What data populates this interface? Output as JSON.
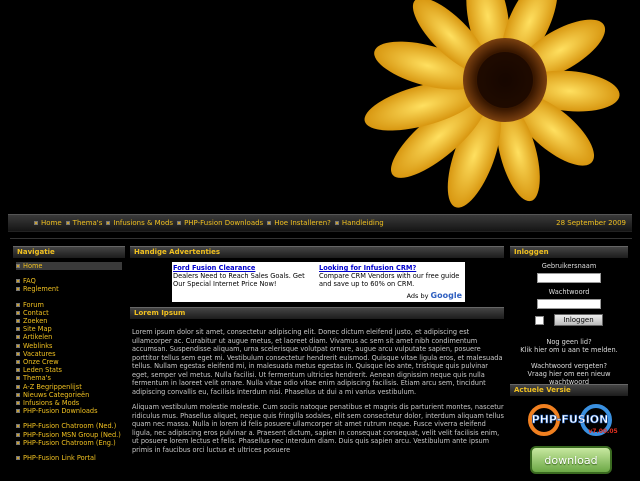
{
  "navbar": {
    "links": [
      "Home",
      "Thema's",
      "Infusions & Mods",
      "PHP-Fusion Downloads",
      "Hoe Installeren?",
      "Handleiding"
    ],
    "date": "28 September 2009"
  },
  "navigation": {
    "title": "Navigatie",
    "groups": [
      [
        "Home"
      ],
      [
        "FAQ",
        "Reglement"
      ],
      [
        "Forum",
        "Contact",
        "Zoeken",
        "Site Map",
        "Artikelen",
        "Weblinks",
        "Vacatures",
        "Onze Crew",
        "Leden Stats",
        "Thema's",
        "A-Z Begrippenlijst",
        "Nieuws Categorieën",
        "Infusions & Mods",
        "PHP-Fusion Downloads"
      ],
      [
        "PHP-Fusion Chatroom (Ned.)",
        "PHP-Fusion MSN Group (Ned.)",
        "PHP-Fusion Chatroom (Eng.)"
      ],
      [
        "PHP-Fusion Link Portal"
      ]
    ]
  },
  "ads": {
    "title": "Handige Advertenties",
    "items": [
      {
        "title": "Ford Fusion Clearance",
        "text": "Dealers Need to Reach Sales Goals. Get Our Special Internet Price Now!"
      },
      {
        "title": "Looking for Infusion CRM?",
        "text": "Compare CRM Vendors with our free guide and save up to 60% on CRM."
      }
    ],
    "adsby": "Ads by",
    "brand": "Google"
  },
  "article": {
    "title": "Lorem Ipsum",
    "paragraphs": [
      "Lorem ipsum dolor sit amet, consectetur adipiscing elit. Donec dictum eleifend justo, et adipiscing est ullamcorper ac. Curabitur ut augue metus, et laoreet diam. Vivamus ac sem sit amet nibh condimentum accumsan. Suspendisse aliquam, urna scelerisque volutpat ornare, augue arcu vulputate sapien, posuere porttitor tellus sem eget mi. Vestibulum consectetur hendrerit euismod. Quisque vitae ligula eros, et malesuada tellus. Nullam egestas eleifend mi, in malesuada metus egestas in. Quisque leo ante, tristique quis pulvinar eget, semper vel metus. Nulla facilisi. Ut fermentum ultricies hendrerit. Aenean dignissim neque quis nulla fermentum in laoreet velit ornare. Nulla vitae odio vitae enim adipiscing facilisis. Etiam arcu sem, tincidunt adipiscing convallis eu, facilisis interdum nisi. Phasellus ut dui a mi varius vestibulum.",
      "Aliquam vestibulum molestie molestie. Cum sociis natoque penatibus et magnis dis parturient montes, nascetur ridiculus mus. Phasellus aliquet, neque quis fringilla sodales, elit sem consectetur dolor, interdum aliquam tellus quam nec massa. Nulla in lorem id felis posuere ullamcorper sit amet rutrum neque. Fusce viverra eleifend ligula, nec adipiscing eros pulvinar a. Praesent dictum, sapien in consequat consequat, velit velit facilisis enim, ut posuere lorem lectus et felis. Phasellus nec interdum diam. Duis quis sapien arcu. Vestibulum ante ipsum primis in faucibus orci luctus et ultrices posuere"
    ]
  },
  "login": {
    "title": "Inloggen",
    "username_label": "Gebruikersnaam",
    "password_label": "Wachtwoord",
    "button": "Inloggen",
    "not_member": "Nog geen lid?",
    "click_here": "Klik hier om u aan te melden.",
    "forgot": "Wachtwoord vergeten?",
    "request": "Vraag hier om een nieuw wachtwoord"
  },
  "version": {
    "title": "Actuele Versie",
    "logo_text": "PHP-FUSION",
    "logo_version": "v7.00.05",
    "download": "download"
  },
  "colors": {
    "accent": "#f0c020",
    "background": "#000000"
  }
}
